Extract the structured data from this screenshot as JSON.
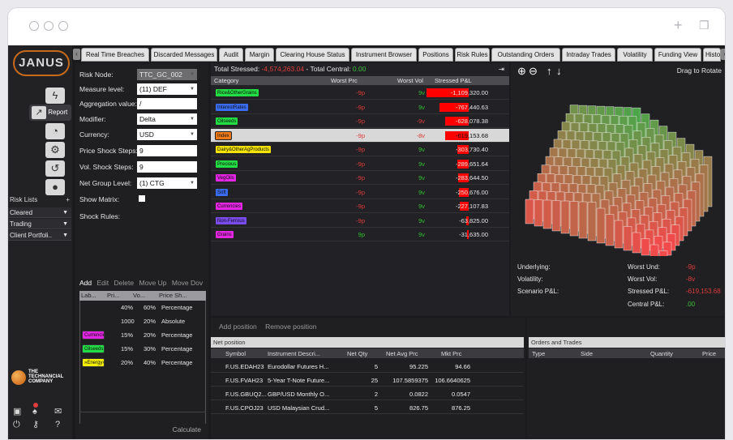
{
  "app": {
    "logo_text": "JANUS"
  },
  "leftnav": {
    "report_label": "Report",
    "risk_lists_label": "Risk Lists",
    "risk_lists_add": "+",
    "dropdowns": [
      "Cleared",
      "Trading",
      "Client Portfoli.."
    ],
    "company_line1": "THE",
    "company_line2": "TECHNANCIAL",
    "company_line3": "COMPANY"
  },
  "tabs": [
    "Real Time Breaches",
    "Discarded Messages",
    "Audit",
    "Margin",
    "Clearing House Status",
    "Instrument Browser",
    "Positions",
    "Risk Rules",
    "Outstanding Orders",
    "Intraday Trades",
    "Volatility",
    "Funding View",
    "Historica"
  ],
  "params": {
    "risk_node": {
      "label": "Risk Node:",
      "value": "TTC_GC_002"
    },
    "measure_level": {
      "label": "Measure level:",
      "value": "(11) DEF"
    },
    "aggregation_value": {
      "label": "Aggregation value:",
      "value": "/"
    },
    "modifier": {
      "label": "Modifier:",
      "value": "Delta"
    },
    "currency": {
      "label": "Currency:",
      "value": "USD"
    },
    "price_shock_steps": {
      "label": "Price Shock Steps:",
      "value": "9"
    },
    "vol_shock_steps": {
      "label": "Vol. Shock Steps:",
      "value": "9"
    },
    "net_group_level": {
      "label": "Net Group Level:",
      "value": "(1) CTG"
    },
    "show_matrix": {
      "label": "Show Matrix:"
    },
    "shock_rules_label": "Shock Rules:",
    "actions": {
      "add": "Add",
      "edit": "Edit",
      "delete": "Delete",
      "move_up": "Move Up",
      "move_down": "Move Dov"
    },
    "rules_header": [
      "Lab...",
      "Pri...",
      "Vo...",
      "Price Sh..."
    ],
    "rules": [
      {
        "label": "",
        "label_color": "",
        "pri": "40%",
        "vol": "60%",
        "type": "Percentage"
      },
      {
        "label": "",
        "label_color": "",
        "pri": "1000",
        "vol": "20%",
        "type": "Absolute"
      },
      {
        "label": "Currencie",
        "label_color": "#e426e4",
        "pri": "15%",
        "vol": "20%",
        "type": "Percentage"
      },
      {
        "label": "Oilseeds",
        "label_color": "#22dd44",
        "pri": "15%",
        "vol": "30%",
        "type": "Percentage"
      },
      {
        "label": "»Energy»",
        "label_color": "#f5f000",
        "pri": "20%",
        "vol": "40%",
        "type": "Percentage"
      }
    ],
    "calculate": "Calculate"
  },
  "grid": {
    "total_stressed_label": "Total Stressed: ",
    "total_stressed_value": "-4,574,263.04",
    "total_central_label": " - Total Central: ",
    "total_central_value": "0.00",
    "columns": [
      "Category",
      "Worst Prc",
      "Worst Vol",
      "Stressed P&L"
    ],
    "rows": [
      {
        "category": "Rice&OtherGrains",
        "color": "#22dd44",
        "prc": "-9p",
        "vol": "9v",
        "pnl": "-1,109,320.00",
        "pnl_value": -1109320.0,
        "selected": false
      },
      {
        "category": "InterestRates",
        "color": "#3a6cf0",
        "prc": "-9p",
        "vol": "9v",
        "pnl": "-767,440.63",
        "pnl_value": -767440.63,
        "selected": false
      },
      {
        "category": "Oilseeds",
        "color": "#22dd44",
        "prc": "-9p",
        "vol": "-9v",
        "pnl": "-628,078.38",
        "pnl_value": -628078.38,
        "selected": false
      },
      {
        "category": "Index",
        "color": "#f07a1a",
        "prc": "-9p",
        "vol": "-8v",
        "pnl": "-619,153.68",
        "pnl_value": -619153.68,
        "selected": true
      },
      {
        "category": "Dairy&OtherAgProducts",
        "color": "#f5e300",
        "prc": "-9p",
        "vol": "9v",
        "pnl": "-303,730.40",
        "pnl_value": -303730.4,
        "selected": false
      },
      {
        "category": "Precious",
        "color": "#22dd44",
        "prc": "-9p",
        "vol": "9v",
        "pnl": "-289,651.64",
        "pnl_value": -289651.64,
        "selected": false
      },
      {
        "category": "VegOils",
        "color": "#e426e4",
        "prc": "-9p",
        "vol": "9v",
        "pnl": "-283,644.50",
        "pnl_value": -283644.5,
        "selected": false
      },
      {
        "category": "Soft",
        "color": "#3a6cf0",
        "prc": "-9p",
        "vol": "9v",
        "pnl": "-250,676.00",
        "pnl_value": -250676.0,
        "selected": false
      },
      {
        "category": "Currencies",
        "color": "#e426e4",
        "prc": "-9p",
        "vol": "9v",
        "pnl": "-227,107.83",
        "pnl_value": -227107.83,
        "selected": false
      },
      {
        "category": "Non-Ferrous",
        "color": "#7a4cf0",
        "prc": "-9p",
        "vol": "9v",
        "pnl": "-63,825.00",
        "pnl_value": -63825.0,
        "selected": false
      },
      {
        "category": "Grains",
        "color": "#e426e4",
        "prc": "9p",
        "vol": "9v",
        "pnl": "-31,635.00",
        "pnl_value": -31635.0,
        "selected": false
      }
    ]
  },
  "chart3d": {
    "drag_label": "Drag to Rotate",
    "underlying_label": "Underlying:",
    "volatility_label": "Volatility:",
    "scenario_label": "Scenario P&L:",
    "worst_und_label": "Worst Und:",
    "worst_und_value": "-9p",
    "worst_vol_label": "Worst Vol:",
    "worst_vol_value": "-8v",
    "stressed_pnl_label": "Stressed P&L:",
    "stressed_pnl_value": "-619,153.68",
    "central_pnl_label": "Central P&L:",
    "central_pnl_value": ".00",
    "colors": {
      "top": "#1fbf4a",
      "bottom": "#f04a4a"
    }
  },
  "positions": {
    "add_label": "Add position",
    "remove_label": "Remove position",
    "net_label": "Net position",
    "columns": [
      "Symbol",
      "Instrument Descri...",
      "Net Qty",
      "Net Avg Prc",
      "Mkt Prc"
    ],
    "rows": [
      {
        "symbol": "F.US.EDAH23",
        "desc": "Eurodollar Futures H...",
        "qty": "5",
        "avg": "95.225",
        "mkt": "94.66"
      },
      {
        "symbol": "F.US.FVAH23",
        "desc": "5-Year T-Note Future...",
        "qty": "25",
        "avg": "107.5859375",
        "mkt": "106.6640625"
      },
      {
        "symbol": "F.US.GBUQ2...",
        "desc": "GBP/USD Monthly O...",
        "qty": "2",
        "avg": "0.0822",
        "mkt": "0.0547"
      },
      {
        "symbol": "F.US.CPOJ23",
        "desc": "USD Malaysian Crud...",
        "qty": "5",
        "avg": "826.75",
        "mkt": "876.25"
      }
    ]
  },
  "orders": {
    "title": "Orders and Trades",
    "columns": [
      "Type",
      "Side",
      "Quantity",
      "Price"
    ]
  }
}
